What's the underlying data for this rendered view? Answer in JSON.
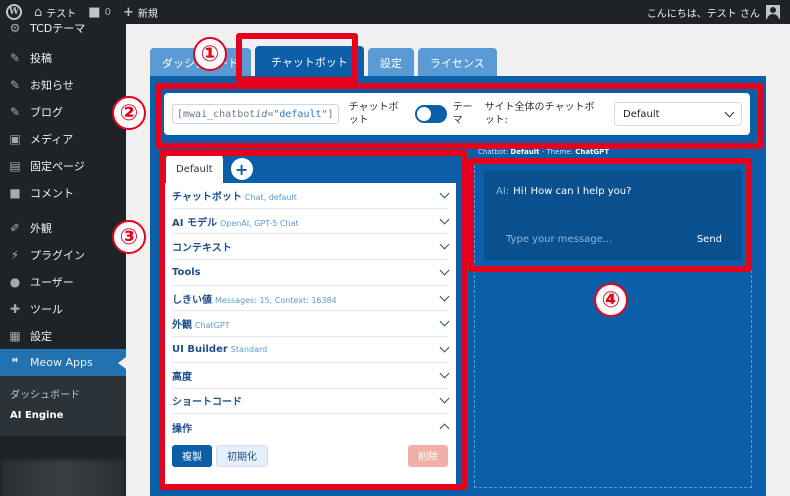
{
  "adminbar": {
    "site_name": "テスト",
    "comments_count": "0",
    "new_label": "新規",
    "greeting": "こんにちは、テスト さん"
  },
  "sidebar": {
    "items": [
      {
        "label": "TCDテーマ",
        "icon": "gear-icon"
      },
      {
        "label": "投稿",
        "icon": "pin-icon"
      },
      {
        "label": "お知らせ",
        "icon": "pin-icon"
      },
      {
        "label": "ブログ",
        "icon": "pin-icon"
      },
      {
        "label": "メディア",
        "icon": "media-icon"
      },
      {
        "label": "固定ページ",
        "icon": "page-icon"
      },
      {
        "label": "コメント",
        "icon": "comment-icon"
      },
      {
        "label": "外観",
        "icon": "brush-icon"
      },
      {
        "label": "プラグイン",
        "icon": "plugin-icon"
      },
      {
        "label": "ユーザー",
        "icon": "user-icon"
      },
      {
        "label": "ツール",
        "icon": "wrench-icon"
      },
      {
        "label": "設定",
        "icon": "settings-icon"
      },
      {
        "label": "Meow Apps",
        "icon": "meow-apps-icon"
      }
    ],
    "submenu": [
      {
        "label": "ダッシュボード"
      },
      {
        "label": "AI Engine"
      }
    ]
  },
  "tabs": [
    {
      "label": "ダッシュボード"
    },
    {
      "label": "チャットボット"
    },
    {
      "label": "設定"
    },
    {
      "label": "ライセンス"
    }
  ],
  "toolbar": {
    "shortcode_prefix": "[mwai_chatbot ",
    "shortcode_attr": "id=",
    "shortcode_value": "\"default\"",
    "shortcode_suffix": "]",
    "chatbot_label": "チャットボット",
    "theme_label": "テーマ",
    "sitewide_label": "サイト全体のチャットボット:",
    "select_value": "Default"
  },
  "left": {
    "tab_label": "Default",
    "plus_label": "+",
    "sections": [
      {
        "title": "チャットボット",
        "sub": "Chat, default"
      },
      {
        "title": "AI モデル",
        "sub": "OpenAI, GPT-5 Chat"
      },
      {
        "title": "コンテキスト",
        "sub": ""
      },
      {
        "title": "Tools",
        "sub": ""
      },
      {
        "title": "しきい値",
        "sub": "Messages: 15, Context: 16384"
      },
      {
        "title": "外観",
        "sub": "ChatGPT"
      },
      {
        "title": "UI Builder",
        "sub": "Standard"
      },
      {
        "title": "高度",
        "sub": ""
      },
      {
        "title": "ショートコード",
        "sub": ""
      },
      {
        "title": "操作",
        "sub": ""
      }
    ],
    "actions": {
      "duplicate": "複製",
      "reset": "初期化",
      "delete": "削除"
    }
  },
  "preview": {
    "chatbot_label": "Chatbot:",
    "chatbot_value": "Default",
    "sep": " - ",
    "theme_label": "Theme:",
    "theme_value": "ChatGPT",
    "ai_prefix": "AI:",
    "greeting": "Hi! How can I help you?",
    "placeholder": "Type your message...",
    "send": "Send"
  },
  "callouts": [
    "①",
    "②",
    "③",
    "④"
  ],
  "colors": {
    "accent": "#0b5ea8",
    "annotation": "#e5001c",
    "admin_dark": "#1d2327"
  }
}
